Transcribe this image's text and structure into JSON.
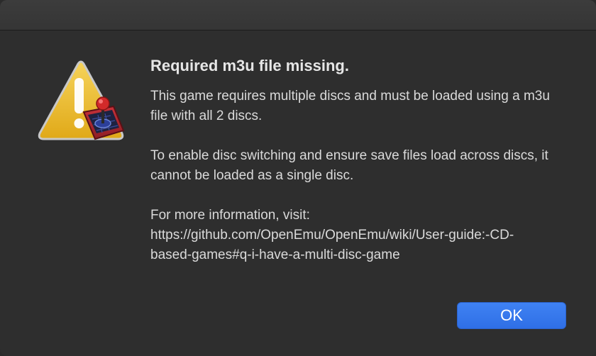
{
  "dialog": {
    "title": "Required m3u file missing.",
    "message_1": "This game requires multiple discs and must be loaded using a m3u file with all 2 discs.",
    "message_2": "To enable disc switching and ensure save files load across discs, it cannot be loaded as a single disc.",
    "message_3_label": "For more information, visit:",
    "message_3_url": "https://github.com/OpenEmu/OpenEmu/wiki/User-guide:-CD-based-games#q-i-have-a-multi-disc-game",
    "ok_label": "OK",
    "icon": "warning-icon",
    "badge_icon": "openemu-joystick-icon"
  },
  "colors": {
    "background": "#2e2e2e",
    "text": "#dadada",
    "accent": "#3478f6",
    "warning": "#f2c12e"
  }
}
